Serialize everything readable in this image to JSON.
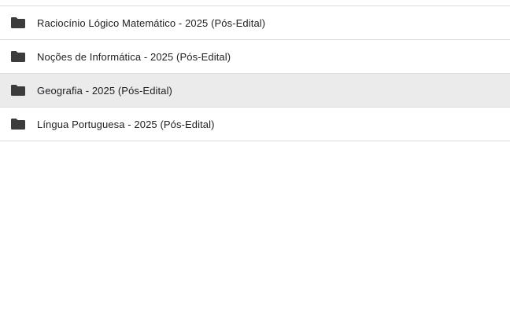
{
  "folders": [
    {
      "name": "Raciocínio Lógico Matemático - 2025 (Pós-Edital)",
      "icon": "folder-icon",
      "selected": false
    },
    {
      "name": "Noções de Informática - 2025 (Pós-Edital)",
      "icon": "folder-icon",
      "selected": false
    },
    {
      "name": "Geografia - 2025 (Pós-Edital)",
      "icon": "folder-icon",
      "selected": true
    },
    {
      "name": "Língua Portuguesa - 2025 (Pós-Edital)",
      "icon": "folder-icon",
      "selected": false
    }
  ],
  "colors": {
    "folder_icon": "#3c3c3c",
    "selected_row": "#ebebeb",
    "divider": "#dadce0",
    "text": "#202124"
  }
}
